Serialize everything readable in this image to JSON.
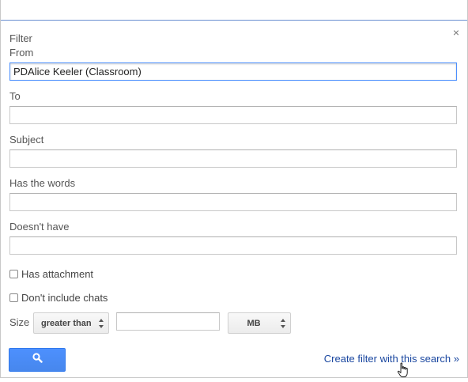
{
  "dialog": {
    "title": "Filter",
    "close_glyph": "×"
  },
  "fields": {
    "from_label": "From",
    "from_value": "PDAlice Keeler (Classroom)",
    "to_label": "To",
    "to_value": "",
    "subject_label": "Subject",
    "subject_value": "",
    "has_words_label": "Has the words",
    "has_words_value": "",
    "doesnt_have_label": "Doesn't have",
    "doesnt_have_value": ""
  },
  "checks": {
    "has_attachment_label": "Has attachment",
    "has_attachment_checked": false,
    "no_chats_label": "Don't include chats",
    "no_chats_checked": false
  },
  "size": {
    "label": "Size",
    "comparator": "greater than",
    "value": "",
    "unit": "MB"
  },
  "actions": {
    "search_icon": "search-icon",
    "create_filter_label": "Create filter with this search »"
  },
  "colors": {
    "accent_blue": "#4d90fe",
    "link_blue": "#1a47a0"
  }
}
